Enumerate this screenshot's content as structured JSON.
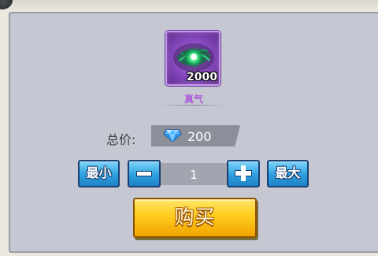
{
  "item": {
    "name": "真气",
    "count": "2000",
    "icon": "green-energy-orb-icon"
  },
  "price": {
    "label": "总价:",
    "currency_icon": "diamond-icon",
    "value": "200"
  },
  "quantity": {
    "min_label": "最小",
    "max_label": "最大",
    "value": "1",
    "decrease_icon": "minus-icon",
    "increase_icon": "plus-icon"
  },
  "buy": {
    "label": "购买"
  },
  "colors": {
    "panel": "#c5c8d3",
    "item_name": "#b05ad8",
    "button_blue": "#2d9fe0",
    "buy_gold": "#ffcc1e"
  }
}
